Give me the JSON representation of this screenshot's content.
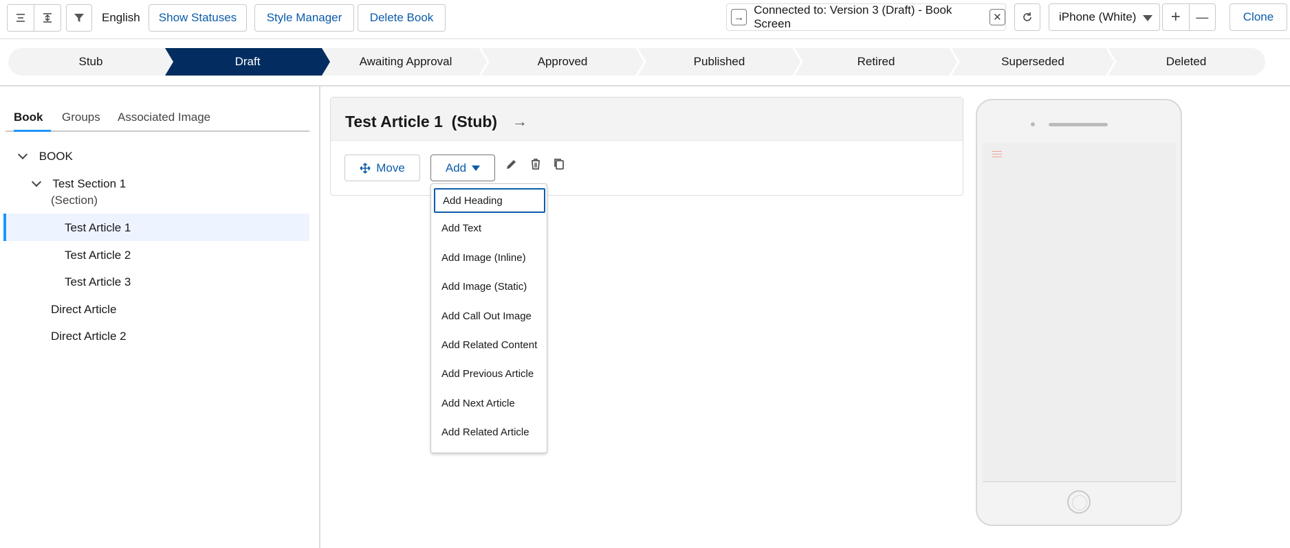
{
  "toolbar": {
    "language": "English",
    "show_statuses": "Show Statuses",
    "style_manager": "Style Manager",
    "delete_book": "Delete Book",
    "connected_text": "Connected to: Version 3 (Draft) - Book Screen",
    "device": "iPhone (White)",
    "zoom_in": "+",
    "zoom_out": "—",
    "clone": "Clone"
  },
  "path": {
    "stages": [
      "Stub",
      "Draft",
      "Awaiting Approval",
      "Approved",
      "Published",
      "Retired",
      "Superseded",
      "Deleted"
    ],
    "active": "Draft",
    "active_color": "#032d60"
  },
  "left": {
    "tabs": [
      "Book",
      "Groups",
      "Associated Image"
    ],
    "active_tab": "Book",
    "tree": {
      "root": "BOOK",
      "section_title": "Test Section 1",
      "section_type": "(Section)",
      "articles": [
        "Test Article 1",
        "Test Article 2",
        "Test Article 3"
      ],
      "selected": "Test Article 1",
      "direct": [
        "Direct Article",
        "Direct Article 2"
      ]
    }
  },
  "card": {
    "title": "Test Article 1",
    "status": "(Stub)",
    "move": "Move",
    "add": "Add"
  },
  "dropdown": {
    "items": [
      "Add Heading",
      "Add Text",
      "Add Image (Inline)",
      "Add Image (Static)",
      "Add Call Out Image",
      "Add Related Content",
      "Add Previous Article",
      "Add Next Article",
      "Add Related Article"
    ],
    "focused": "Add Heading"
  },
  "colors": {
    "brand_blue": "#0b5cab",
    "accent_blue": "#1b96ff"
  }
}
